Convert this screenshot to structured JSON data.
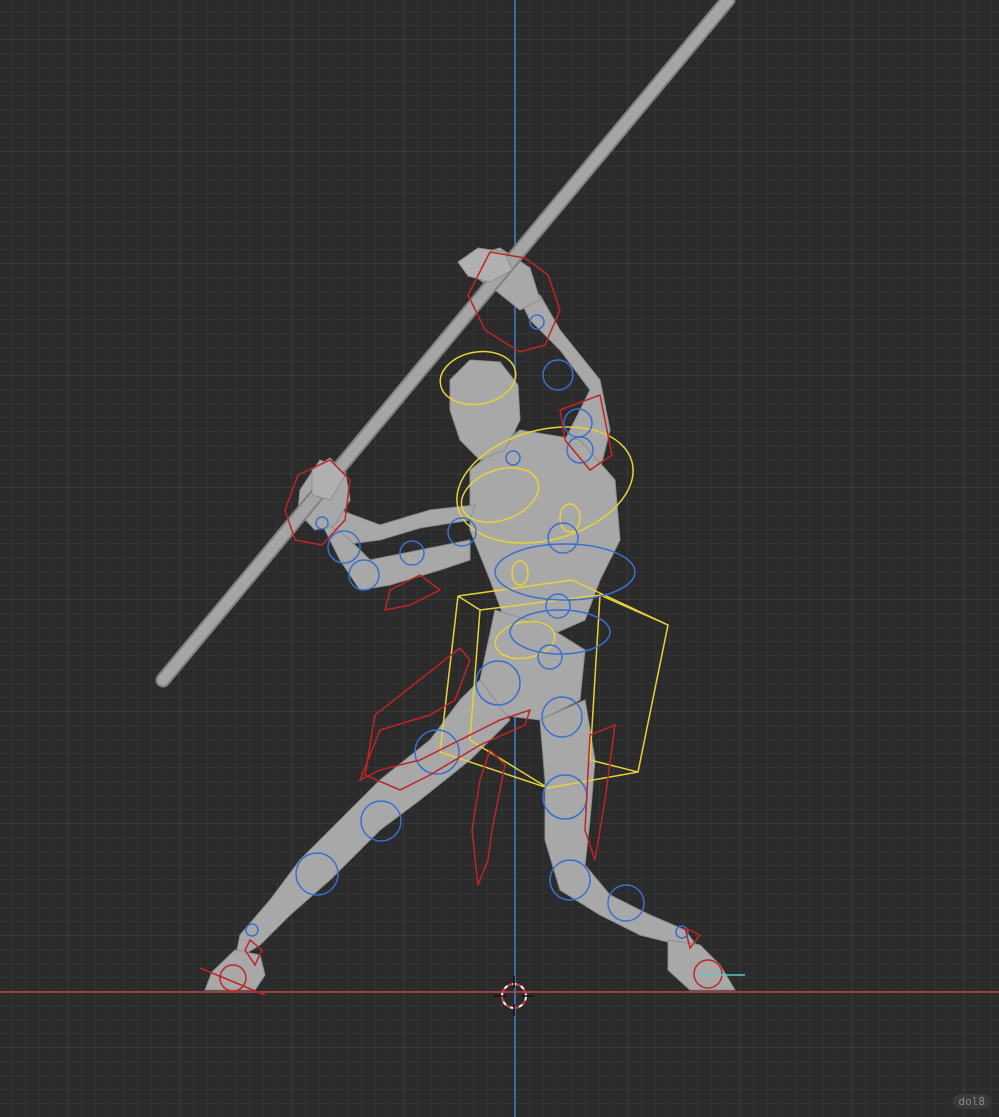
{
  "app": {
    "type": "3d-viewport",
    "mode": "pose",
    "watermark": "dol8"
  },
  "colors": {
    "background": "#2b2b2b",
    "grid_major": "#3a3a3a",
    "grid_minor": "#333333",
    "x_axis": "#b84545",
    "z_axis": "#3f7fc4",
    "mesh": "#a8a8a8",
    "control_fk": "#3a6fd0",
    "control_ik": "#c02424",
    "control_selected": "#e6d238"
  },
  "icons": {
    "cursor": "3d-cursor-icon"
  }
}
